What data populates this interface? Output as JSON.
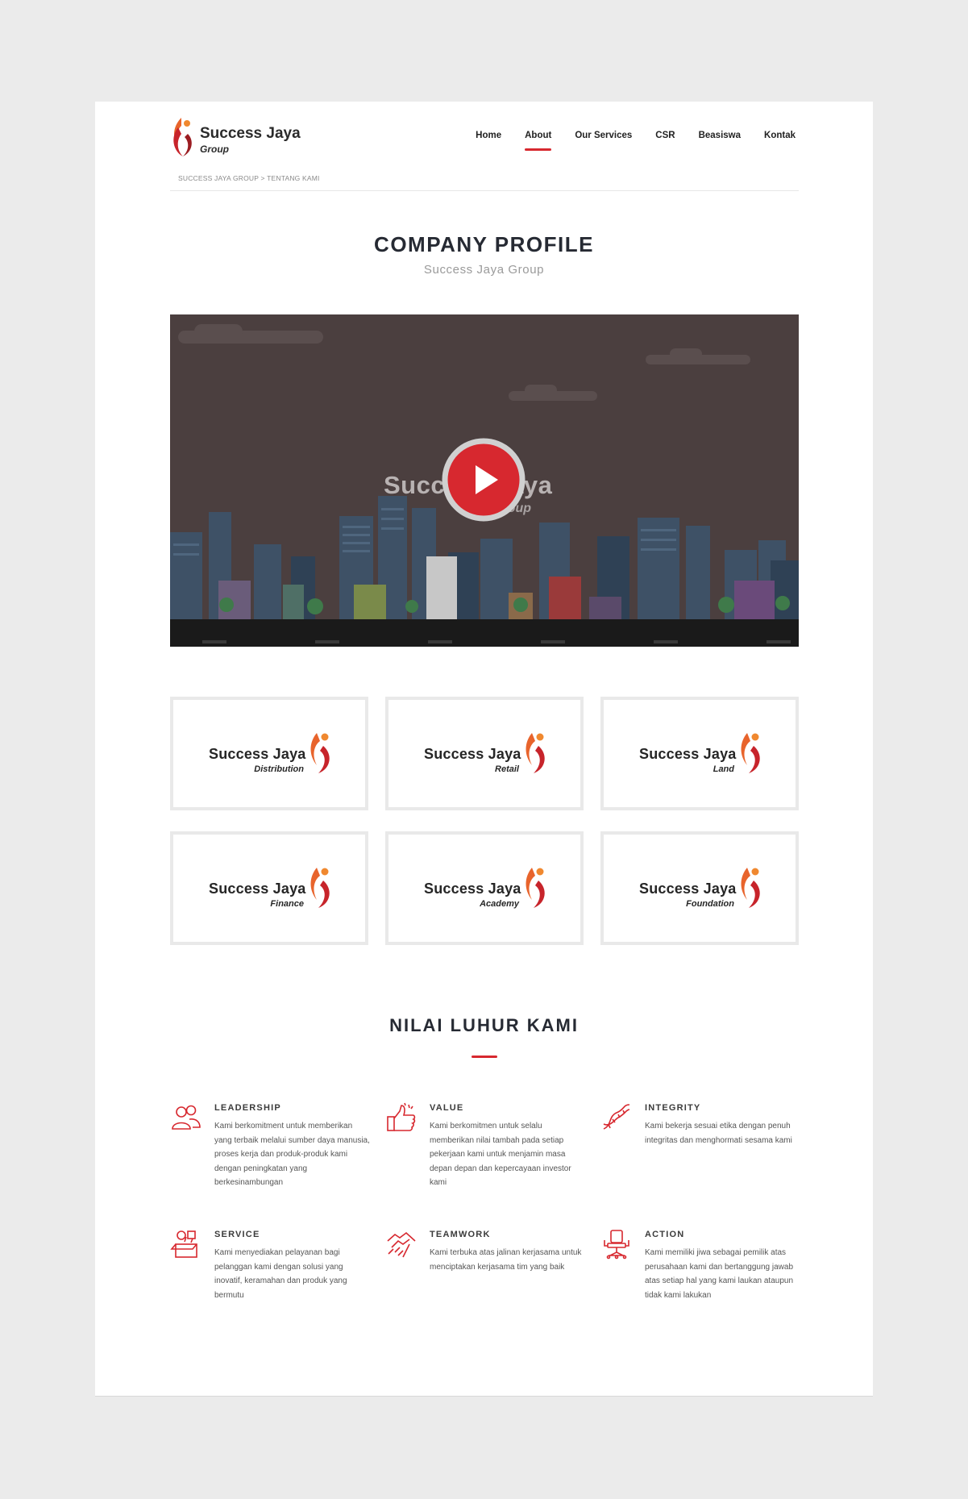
{
  "brand": {
    "name": "Success Jaya",
    "sub": "Group",
    "accent": "#d7282f"
  },
  "nav": [
    {
      "label": "Home",
      "active": false
    },
    {
      "label": "About",
      "active": true
    },
    {
      "label": "Our Services",
      "active": false
    },
    {
      "label": "CSR",
      "active": false
    },
    {
      "label": "Beasiswa",
      "active": false
    },
    {
      "label": "Kontak",
      "active": false
    }
  ],
  "breadcrumb": "SUCCESS JAYA GROUP > TENTANG KAMI",
  "profile": {
    "title": "COMPANY PROFILE",
    "subtitle": "Success Jaya Group"
  },
  "video": {
    "brand": "Success Jaya",
    "sub": "Group"
  },
  "subsidiaries": [
    {
      "name": "Success Jaya",
      "sub": "Distribution"
    },
    {
      "name": "Success Jaya",
      "sub": "Retail"
    },
    {
      "name": "Success Jaya",
      "sub": "Land"
    },
    {
      "name": "Success Jaya",
      "sub": "Finance"
    },
    {
      "name": "Success Jaya",
      "sub": "Academy"
    },
    {
      "name": "Success Jaya",
      "sub": "Foundation"
    }
  ],
  "values_section": {
    "title": "NILAI LUHUR KAMI",
    "items": [
      {
        "icon": "people-icon",
        "title": "LEADERSHIP",
        "text": "Kami berkomitment untuk memberikan yang terbaik melalui sumber daya manusia, proses kerja dan produk-produk kami dengan peningkatan yang berkesinambungan"
      },
      {
        "icon": "thumbs-up-icon",
        "title": "VALUE",
        "text": "Kami berkomitmen untuk selalu memberikan nilai tambah pada setiap pekerjaan kami untuk menjamin masa depan depan dan kepercayaan investor kami"
      },
      {
        "icon": "dna-icon",
        "title": "INTEGRITY",
        "text": "Kami bekerja sesuai etika dengan penuh integritas dan menghormati sesama kami"
      },
      {
        "icon": "service-box-icon",
        "title": "SERVICE",
        "text": "Kami menyediakan pelayanan bagi pelanggan kami dengan solusi yang inovatif, keramahan dan produk yang bermutu"
      },
      {
        "icon": "handshake-icon",
        "title": "TEAMWORK",
        "text": "Kami terbuka atas jalinan kerjasama untuk menciptakan kerjasama tim yang baik"
      },
      {
        "icon": "office-chair-icon",
        "title": "ACTION",
        "text": "Kami memiliki jiwa sebagai pemilik atas perusahaan kami dan bertanggung jawab atas setiap hal yang kami laukan ataupun tidak kami lakukan"
      }
    ]
  }
}
